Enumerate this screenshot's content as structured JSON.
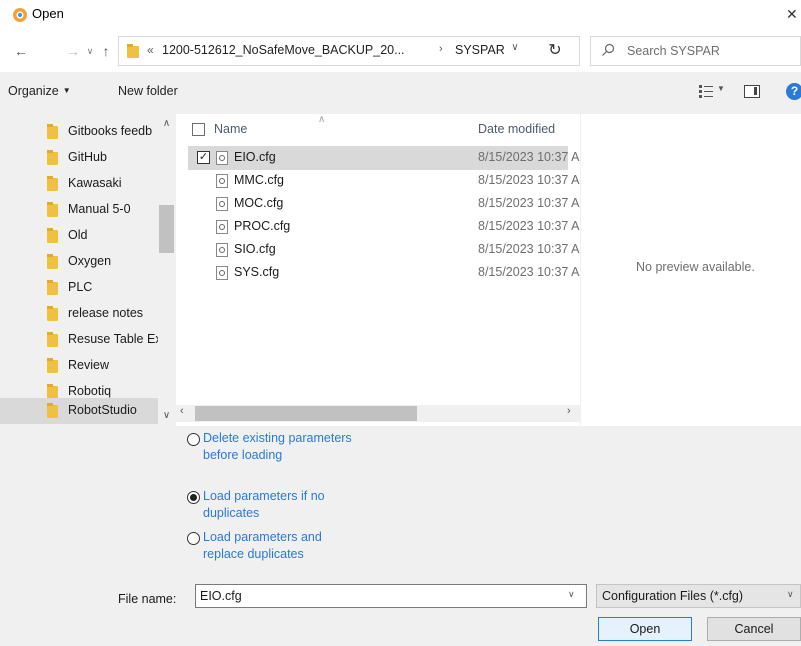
{
  "window": {
    "title": "Open",
    "close_glyph": "✕"
  },
  "nav": {
    "back_glyph": "←",
    "forward_glyph": "→",
    "recent_glyph": "∨",
    "up_glyph": "↑"
  },
  "address": {
    "chevron": "«",
    "segment_1": "1200-512612_NoSafeMove_BACKUP_20...",
    "separator": "›",
    "segment_2": "SYSPAR",
    "dropdown_glyph": "∨",
    "refresh_glyph": "↻"
  },
  "search": {
    "placeholder": "Search SYSPAR"
  },
  "toolbar": {
    "organize_label": "Organize",
    "organize_caret": "▼",
    "new_folder_label": "New folder",
    "view_caret": "▼",
    "help_label": "?"
  },
  "nav_pane": {
    "items": [
      {
        "label": "Gitbooks feedb"
      },
      {
        "label": "GitHub"
      },
      {
        "label": "Kawasaki"
      },
      {
        "label": "Manual 5-0"
      },
      {
        "label": "Old"
      },
      {
        "label": "Oxygen"
      },
      {
        "label": "PLC"
      },
      {
        "label": "release notes"
      },
      {
        "label": "Resuse Table Ex"
      },
      {
        "label": "Review"
      },
      {
        "label": "Robotiq"
      },
      {
        "label": "RobotStudio"
      }
    ],
    "selected": "RobotStudio",
    "scroll_up": "∧",
    "scroll_down": "∨"
  },
  "file_list": {
    "columns": {
      "name": "Name",
      "date": "Date modified"
    },
    "sort_caret": "∧",
    "rows": [
      {
        "name": "EIO.cfg",
        "date": "8/15/2023 10:37 A",
        "checked": true
      },
      {
        "name": "MMC.cfg",
        "date": "8/15/2023 10:37 A",
        "checked": false
      },
      {
        "name": "MOC.cfg",
        "date": "8/15/2023 10:37 A",
        "checked": false
      },
      {
        "name": "PROC.cfg",
        "date": "8/15/2023 10:37 A",
        "checked": false
      },
      {
        "name": "SIO.cfg",
        "date": "8/15/2023 10:37 A",
        "checked": false
      },
      {
        "name": "SYS.cfg",
        "date": "8/15/2023 10:37 A",
        "checked": false
      }
    ],
    "check_glyph": "✓",
    "hscroll_left": "‹",
    "hscroll_right": "›"
  },
  "preview": {
    "text": "No preview available."
  },
  "options": {
    "radios": [
      {
        "label": "Delete existing parameters before loading",
        "checked": false
      },
      {
        "label": "Load parameters if no duplicates",
        "checked": true
      },
      {
        "label": "Load parameters and replace duplicates",
        "checked": false
      }
    ]
  },
  "file_name": {
    "label": "File name:",
    "value": "EIO.cfg",
    "dropdown_glyph": "∨"
  },
  "file_type": {
    "selected": "Configuration Files (*.cfg)",
    "dropdown_glyph": "∨"
  },
  "buttons": {
    "open": "Open",
    "cancel": "Cancel"
  },
  "colors": {
    "accent": "#2a7ad6",
    "selection": "#d9d9d9",
    "folder": "#f0c040"
  }
}
